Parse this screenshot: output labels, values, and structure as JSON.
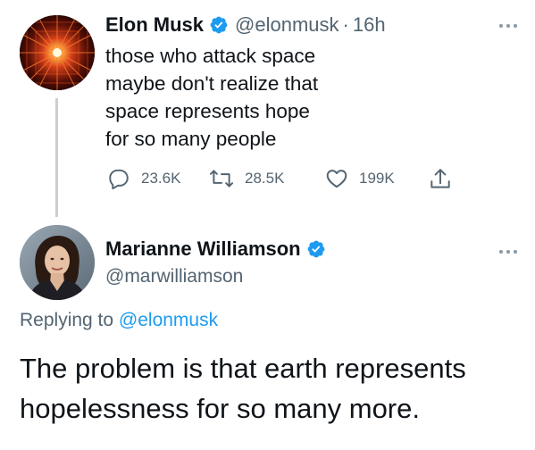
{
  "tweet1": {
    "name": "Elon Musk",
    "handle": "@elonmusk",
    "separator": "·",
    "time": "16h",
    "text_lines": [
      "those who attack space",
      "maybe don't realize that",
      "space represents hope",
      "for so many people"
    ],
    "stats": {
      "replies": "23.6K",
      "retweets": "28.5K",
      "likes": "199K"
    }
  },
  "tweet2": {
    "name": "Marianne Williamson",
    "handle": "@marwilliamson",
    "replying_prefix": "Replying to",
    "replying_to": "@elonmusk",
    "text_lines": [
      "The problem is that earth represents",
      "hopelessness for so many more."
    ]
  },
  "icons": {
    "verified": "verified-badge-icon",
    "reply": "comment-icon",
    "retweet": "retweet-icon",
    "like": "heart-icon",
    "share": "share-icon",
    "more": "more-dots-icon"
  },
  "colors": {
    "verified_blue": "#1d9bf0",
    "link_blue": "#1d9bf0",
    "secondary_text": "#536471",
    "thread_line": "#c8d0d6"
  }
}
